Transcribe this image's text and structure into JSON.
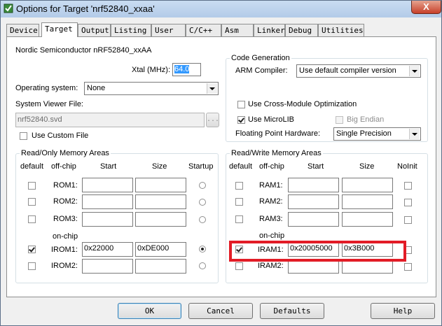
{
  "window": {
    "title": "Options for Target 'nrf52840_xxaa'",
    "close_glyph": "X"
  },
  "tabs": [
    {
      "label": "Device"
    },
    {
      "label": "Target"
    },
    {
      "label": "Output"
    },
    {
      "label": "Listing"
    },
    {
      "label": "User"
    },
    {
      "label": "C/C++"
    },
    {
      "label": "Asm"
    },
    {
      "label": "Linker"
    },
    {
      "label": "Debug"
    },
    {
      "label": "Utilities"
    }
  ],
  "device_name": "Nordic Semiconductor nRF52840_xxAA",
  "xtal": {
    "label": "Xtal (MHz):",
    "value": "64.0"
  },
  "os": {
    "label": "Operating system:",
    "value": "None"
  },
  "svd": {
    "label": "System Viewer File:",
    "value": "nrf52840.svd",
    "browse": "..."
  },
  "custom_file": {
    "label": "Use Custom File",
    "checked": false
  },
  "codegen": {
    "title": "Code Generation",
    "compiler_label": "ARM Compiler:",
    "compiler_value": "Use default compiler version",
    "cross_module": {
      "label": "Use Cross-Module Optimization",
      "checked": false
    },
    "microlib": {
      "label": "Use MicroLIB",
      "checked": true
    },
    "big_endian": {
      "label": "Big Endian",
      "checked": false
    },
    "fpu_label": "Floating Point Hardware:",
    "fpu_value": "Single Precision"
  },
  "rom": {
    "title": "Read/Only Memory Areas",
    "headers": {
      "default": "default",
      "offchip": "off-chip",
      "start": "Start",
      "size": "Size",
      "last": "Startup"
    },
    "onchip_label": "on-chip",
    "rows": [
      {
        "label": "ROM1:",
        "start": "",
        "size": "",
        "default": false,
        "radio": false
      },
      {
        "label": "ROM2:",
        "start": "",
        "size": "",
        "default": false,
        "radio": false
      },
      {
        "label": "ROM3:",
        "start": "",
        "size": "",
        "default": false,
        "radio": false
      },
      {
        "label": "IROM1:",
        "start": "0x22000",
        "size": "0xDE000",
        "default": true,
        "radio": true
      },
      {
        "label": "IROM2:",
        "start": "",
        "size": "",
        "default": false,
        "radio": false
      }
    ]
  },
  "ram": {
    "title": "Read/Write Memory Areas",
    "headers": {
      "default": "default",
      "offchip": "off-chip",
      "start": "Start",
      "size": "Size",
      "last": "NoInit"
    },
    "onchip_label": "on-chip",
    "rows": [
      {
        "label": "RAM1:",
        "start": "",
        "size": "",
        "default": false
      },
      {
        "label": "RAM2:",
        "start": "",
        "size": "",
        "default": false
      },
      {
        "label": "RAM3:",
        "start": "",
        "size": "",
        "default": false
      },
      {
        "label": "IRAM1:",
        "start": "0x20005000",
        "size": "0x3B000",
        "default": true
      },
      {
        "label": "IRAM2:",
        "start": "",
        "size": "",
        "default": false
      }
    ]
  },
  "buttons": {
    "ok": "OK",
    "cancel": "Cancel",
    "defaults": "Defaults",
    "help": "Help"
  },
  "colors": {
    "highlight": "#e21c26",
    "selected_bg": "#3399ff"
  }
}
